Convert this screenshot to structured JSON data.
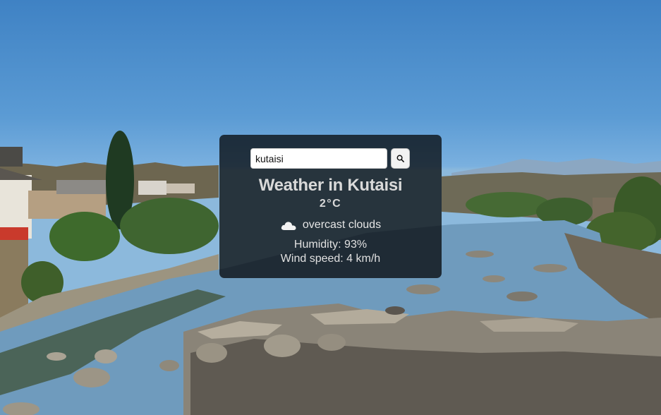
{
  "search": {
    "value": "kutaisi",
    "button_icon": "search-icon"
  },
  "weather": {
    "title": "Weather in Kutaisi",
    "temperature": "2°C",
    "icon": "cloud-icon",
    "description": "overcast clouds",
    "humidity": "Humidity: 93%",
    "wind": "Wind speed: 4 km/h"
  },
  "colors": {
    "card_background": "#000000",
    "sky": "#5b9bd4",
    "river": "#7aa6c8"
  }
}
